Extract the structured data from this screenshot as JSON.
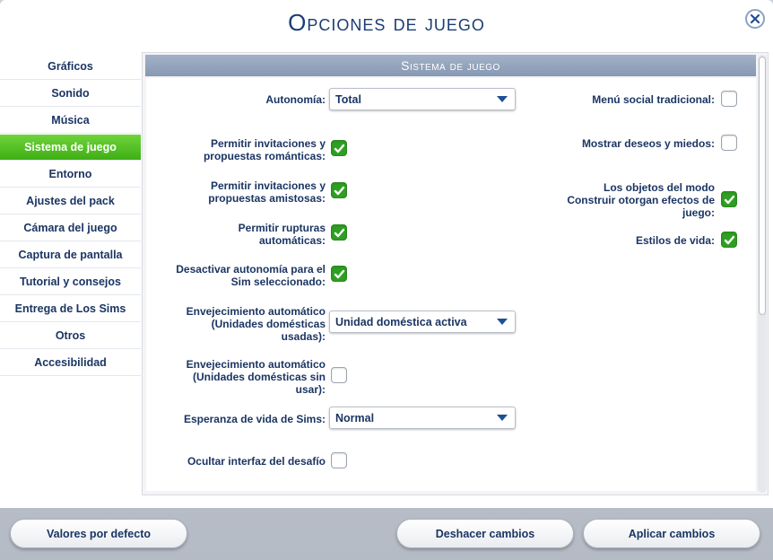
{
  "title": "Opciones de juego",
  "sidebar": {
    "items": [
      {
        "label": "Gráficos"
      },
      {
        "label": "Sonido"
      },
      {
        "label": "Música"
      },
      {
        "label": "Sistema de juego"
      },
      {
        "label": "Entorno"
      },
      {
        "label": "Ajustes del pack"
      },
      {
        "label": "Cámara del juego"
      },
      {
        "label": "Captura de pantalla"
      },
      {
        "label": "Tutorial y consejos"
      },
      {
        "label": "Entrega de Los Sims"
      },
      {
        "label": "Otros"
      },
      {
        "label": "Accesibilidad"
      }
    ],
    "active_index": 3
  },
  "panel": {
    "header": "Sistema de juego",
    "left": {
      "autonomy_label": "Autonomía:",
      "autonomy_value": "Total",
      "romantic_label_1": "Permitir invitaciones y",
      "romantic_label_2": "propuestas románticas:",
      "romantic_checked": true,
      "friendly_label_1": "Permitir invitaciones y",
      "friendly_label_2": "propuestas amistosas:",
      "friendly_checked": true,
      "breakups_label_1": "Permitir rupturas",
      "breakups_label_2": "automáticas:",
      "breakups_checked": true,
      "disable_autonomy_label_1": "Desactivar autonomía para el",
      "disable_autonomy_label_2": "Sim seleccionado:",
      "disable_autonomy_checked": true,
      "aging_used_label_1": "Envejecimiento automático",
      "aging_used_label_2": "(Unidades domésticas",
      "aging_used_label_3": "usadas):",
      "aging_used_value": "Unidad doméstica activa",
      "aging_unused_label_1": "Envejecimiento automático",
      "aging_unused_label_2": "(Unidades domésticas sin",
      "aging_unused_label_3": "usar):",
      "aging_unused_checked": false,
      "lifespan_label": "Esperanza de vida de Sims:",
      "lifespan_value": "Normal",
      "hide_challenge_label": "Ocultar interfaz del desafío",
      "hide_challenge_checked": false
    },
    "right": {
      "social_menu_label": "Menú social tradicional:",
      "social_menu_checked": false,
      "wants_fears_label": "Mostrar deseos y miedos:",
      "wants_fears_checked": false,
      "build_effects_label_1": "Los objetos del modo",
      "build_effects_label_2": "Construir otorgan efectos de",
      "build_effects_label_3": "juego:",
      "build_effects_checked": true,
      "lifestyles_label": "Estilos de vida:",
      "lifestyles_checked": true
    }
  },
  "footer": {
    "defaults_label": "Valores por defecto",
    "undo_label": "Deshacer cambios",
    "apply_label": "Aplicar cambios"
  },
  "colors": {
    "active_tab": "#4cbf1f",
    "checkbox_checked": "#2f9f23",
    "text": "#1b3563",
    "header_bar": "#94a4bd"
  }
}
